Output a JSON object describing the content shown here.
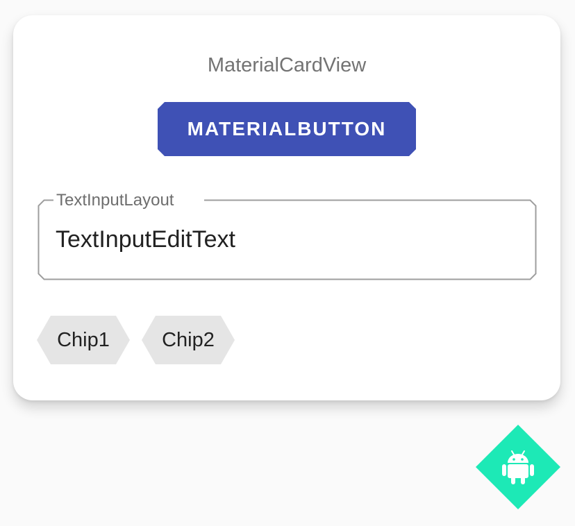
{
  "card": {
    "title": "MaterialCardView"
  },
  "button": {
    "label": "MATERIALBUTTON"
  },
  "text_input": {
    "label": "TextInputLayout",
    "value": "TextInputEditText"
  },
  "chips": [
    {
      "label": "Chip1"
    },
    {
      "label": "Chip2"
    }
  ],
  "fab": {
    "icon": "android-icon"
  },
  "colors": {
    "button_bg": "#3f51b5",
    "fab_bg": "#1de9b6",
    "chip_bg": "#e5e5e5",
    "outline": "#9e9e9e"
  }
}
